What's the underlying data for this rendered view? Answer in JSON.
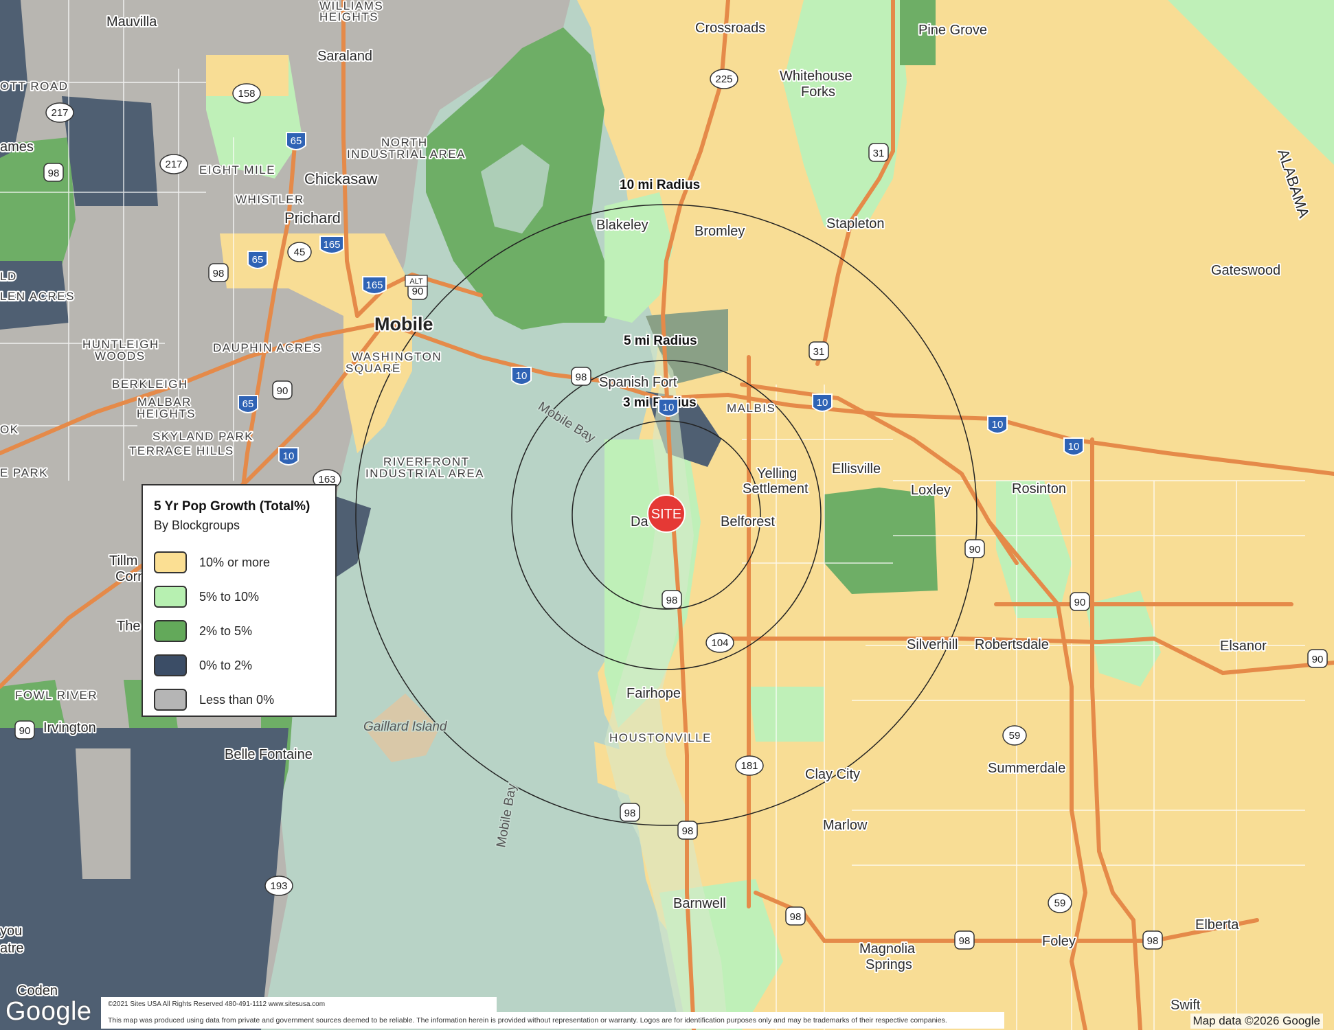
{
  "legend": {
    "title": "5 Yr Pop Growth (Total%)",
    "subtitle": "By Blockgroups",
    "items": [
      {
        "label": "10% or more",
        "color": "#fbdf93"
      },
      {
        "label": "5% to 10%",
        "color": "#b7f0b1"
      },
      {
        "label": "2% to 5%",
        "color": "#63a95a"
      },
      {
        "label": "0% to 2%",
        "color": "#3b4d66"
      },
      {
        "label": "Less than 0%",
        "color": "#b5b5b5"
      }
    ]
  },
  "site": {
    "label": "SITE",
    "color": "#e53935"
  },
  "radii": {
    "r3": "3 mi Radius",
    "r5": "5 mi Radius",
    "r10": "10 mi Radius"
  },
  "places": {
    "mauvilla": "Mauvilla",
    "williams1": "WILLIAMS",
    "williams2": "HEIGHTS",
    "saraland": "Saraland",
    "crossroads": "Crossroads",
    "pinegrove": "Pine Grove",
    "whitehouse1": "Whitehouse",
    "whitehouse2": "Forks",
    "ottroad": "OTT ROAD",
    "ames": "ames",
    "north1": "NORTH",
    "north2": "INDUSTRIAL AREA",
    "eightmile": "EIGHT MILE",
    "chickasaw": "Chickasaw",
    "whistler": "WHISTLER",
    "prichard": "Prichard",
    "blakeley": "Blakeley",
    "bromley": "Bromley",
    "stapleton": "Stapleton",
    "alabama": "ALABAMA",
    "gateswood": "Gateswood",
    "ld": "LD",
    "lenacres": "LEN ACRES",
    "mobile": "Mobile",
    "huntleigh1": "HUNTLEIGH",
    "huntleigh2": "WOODS",
    "dauphin": "DAUPHIN ACRES",
    "washington1": "WASHINGTON",
    "washington2": "SQUARE",
    "berkleigh": "BERKLEIGH",
    "malbar1": "MALBAR",
    "malbar2": "HEIGHTS",
    "skyland": "SKYLAND PARK",
    "terrace": "TERRACE HILLS",
    "ok": "OK",
    "epark": "E PARK",
    "spanishfort": "Spanish Fort",
    "malbis": "MALBIS",
    "mobilebay": "Mobile Bay",
    "riverfront1": "RIVERFRONT",
    "riverfront2": "INDUSTRIAL AREA",
    "yelling1": "Yelling",
    "yelling2": "Settlement",
    "ellisville": "Ellisville",
    "loxley": "Loxley",
    "rosinton": "Rosinton",
    "da": "Da",
    "belforest": "Belforest",
    "tillm": "Tillm",
    "corn": "Corn",
    "the": "The",
    "silverhill": "Silverhill",
    "robertsdale": "Robertsdale",
    "elsanor": "Elsanor",
    "fowlriver": "FOWL RIVER",
    "irvington": "Irvington",
    "fairhope": "Fairhope",
    "houstonville": "HOUSTONVILLE",
    "gaillard": "Gaillard Island",
    "bellefontaine": "Belle Fontaine",
    "claycity": "Clay City",
    "summerdale": "Summerdale",
    "mobilebay2": "Mobile Bay",
    "marlow": "Marlow",
    "barnwell": "Barnwell",
    "you": "you",
    "atre": "atre",
    "magnolia1": "Magnolia",
    "magnolia2": "Springs",
    "foley": "Foley",
    "elberta": "Elberta",
    "coden": "Coden",
    "swift": "Swift"
  },
  "shields": {
    "i65a": "65",
    "i65b": "65",
    "i65c": "65",
    "i165a": "165",
    "i165b": "165",
    "i10a": "10",
    "i10b": "10",
    "i10c": "10",
    "i10d": "10",
    "i10e": "10",
    "i10f": "10",
    "us98a": "98",
    "us98b": "98",
    "us98c": "98",
    "us98d": "98",
    "us98e": "98",
    "us98f": "98",
    "us98g": "98",
    "us98h": "98",
    "us98i": "98",
    "us90a": "90",
    "us90b": "90",
    "us90c": "90",
    "us90d": "90",
    "us90e": "90",
    "us90f": "90",
    "us31a": "31",
    "us31b": "31",
    "sr225": "225",
    "sr158": "158",
    "sr217a": "217",
    "sr217b": "217",
    "sr45": "45",
    "sr163": "163",
    "sr104": "104",
    "sr181": "181",
    "sr59a": "59",
    "sr59b": "59",
    "sr193": "193",
    "alt": "ALT"
  },
  "footer": {
    "line1": "©2021 Sites USA    All Rights Reserved    480-491-1112    www.sitesusa.com",
    "line2": "This map was produced using data from private and government sources deemed to be reliable. The information herein is provided without representation or warranty. Logos are for identification purposes only and may be trademarks of their respective companies.",
    "google": "Google",
    "mapdata": "Map data ©2026 Google"
  }
}
